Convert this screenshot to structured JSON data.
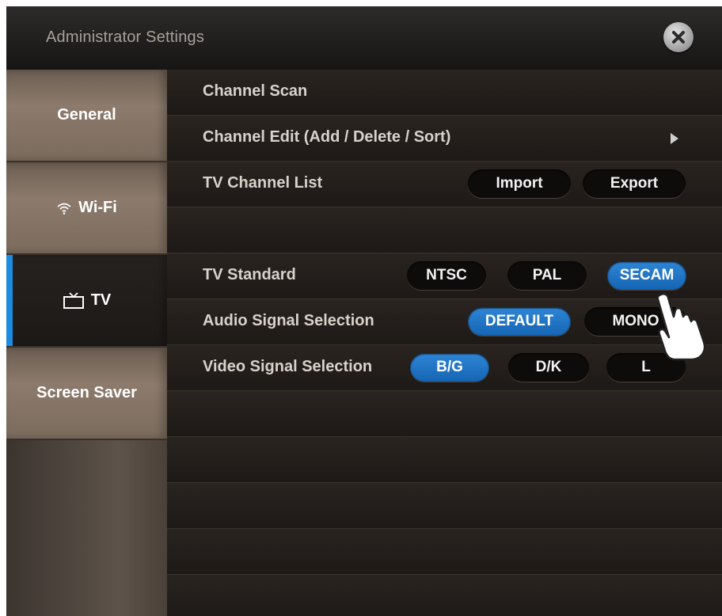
{
  "window": {
    "title": "Administrator Settings"
  },
  "sidebar": {
    "items": [
      {
        "label": "General",
        "icon": "none"
      },
      {
        "label": "Wi-Fi",
        "icon": "wifi-icon"
      },
      {
        "label": "TV",
        "icon": "tv-icon",
        "active": true
      },
      {
        "label": "Screen Saver",
        "icon": "none"
      }
    ],
    "accent_color": "#1c8be0"
  },
  "content": {
    "channel_scan": "Channel Scan",
    "channel_edit": "Channel  Edit (Add / Delete / Sort)",
    "tv_channel_list": {
      "label": "TV Channel List",
      "import": "Import",
      "export": "Export"
    },
    "tv_standard": {
      "label": "TV Standard",
      "options": [
        "NTSC",
        "PAL",
        "SECAM"
      ],
      "selected": "SECAM"
    },
    "audio_signal": {
      "label": "Audio Signal Selection",
      "options": [
        "DEFAULT",
        "MONO"
      ],
      "selected": "DEFAULT"
    },
    "video_signal": {
      "label": "Video Signal Selection",
      "options": [
        "B/G",
        "D/K",
        "L"
      ],
      "selected": "B/G"
    }
  },
  "selected_color": "#1c73c4"
}
